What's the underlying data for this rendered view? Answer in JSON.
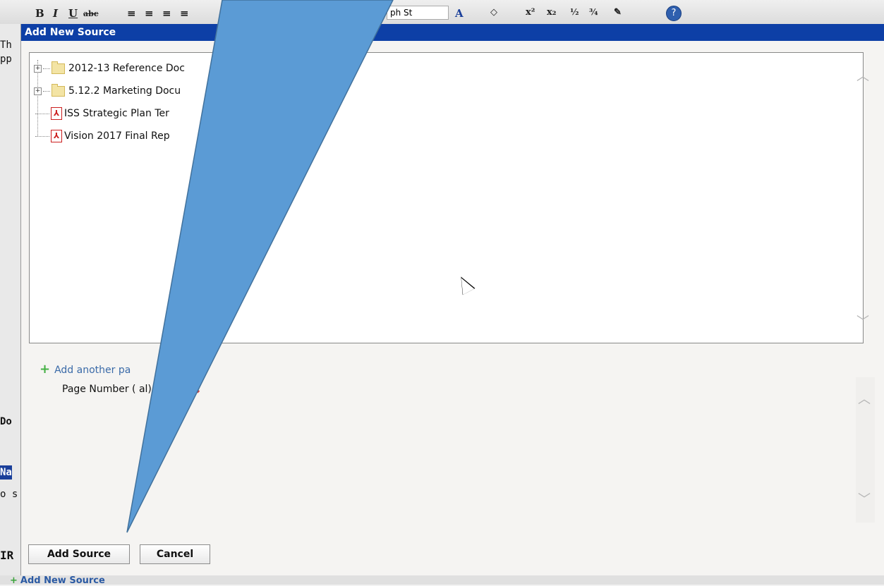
{
  "background": {
    "toolbar": {
      "bold": "B",
      "italic": "I",
      "underline": "U",
      "strike": "abc",
      "paragraph_style": "ph St",
      "font_color": "A",
      "superscript": "x²",
      "subscript": "x₂",
      "help": "?"
    },
    "left_fragments": [
      "Th",
      "pp",
      "Do",
      "Na",
      "o s",
      "IR"
    ],
    "bottom_link": "Add New Source"
  },
  "modal": {
    "title": "Add New Source",
    "tree": {
      "items": [
        {
          "type": "folder",
          "label": "2012-13 Reference Doc",
          "expandable": true
        },
        {
          "type": "folder",
          "label": "5.12.2 Marketing Docu",
          "expandable": true
        },
        {
          "type": "pdf",
          "label": "ISS Strategic Plan Ter"
        },
        {
          "type": "pdf",
          "label": "Vision 2017 Final Rep"
        }
      ]
    },
    "add_another_label": "Add another pa",
    "page_number_label": "Page Number (   al):",
    "page_number_value": "",
    "buttons": {
      "add_source": "Add Source",
      "cancel": "Cancel"
    }
  },
  "colors": {
    "titlebar": "#0d3fa6",
    "callout_fill": "#5b9bd5",
    "callout_stroke": "#41719c",
    "link": "#3a6aa8",
    "remove": "#d04040",
    "plus": "#45b045"
  },
  "icons": {
    "tree_folder": "folder-icon",
    "tree_pdf": "pdf-icon",
    "expander": "plus-box-icon",
    "add": "plus-icon",
    "remove": "close-x-icon",
    "cursor": "mouse-pointer-icon"
  }
}
